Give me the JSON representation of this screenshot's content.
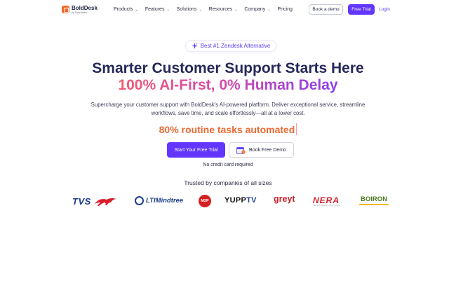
{
  "brand": {
    "name": "BoldDesk",
    "byline": "by Syncfusion",
    "accent": "#6236ff",
    "logo_color": "#f26b2a"
  },
  "nav": {
    "items": [
      {
        "label": "Products",
        "has_dropdown": true
      },
      {
        "label": "Features",
        "has_dropdown": true
      },
      {
        "label": "Solutions",
        "has_dropdown": true
      },
      {
        "label": "Resources",
        "has_dropdown": true
      },
      {
        "label": "Company",
        "has_dropdown": true
      },
      {
        "label": "Pricing",
        "has_dropdown": false
      }
    ],
    "book_demo": "Book a demo",
    "free_trial": "Free Trial",
    "login": "Login"
  },
  "hero": {
    "badge": "Best #1 Zendesk Alternative",
    "headline_1": "Smarter Customer Support Starts Here",
    "headline_2": "100% AI-First, 0% Human Delay",
    "sub_line_1": "Supercharge your customer support with BoldDesk's AI-powered platform. Deliver exceptional service, streamline",
    "sub_line_2": "workflows, save time, and scale effortlessly—all at a lower cost.",
    "automated": "80% routine tasks automated",
    "cta_primary": "Start Your Free Trial",
    "cta_secondary": "Book Free Demo",
    "note": "No credit card required"
  },
  "trusted": {
    "heading": "Trusted by companies of all sizes",
    "logos": {
      "tvs": "TVS",
      "lti": "LTIMindtree",
      "m2p": "M2P",
      "yupp_a": "YUPP",
      "yupp_b": "TV",
      "greyt": "greyt",
      "nera": "NERA",
      "nera_tag": "TELECOMMUNICATIONS",
      "boiron": "BOIRON"
    }
  }
}
